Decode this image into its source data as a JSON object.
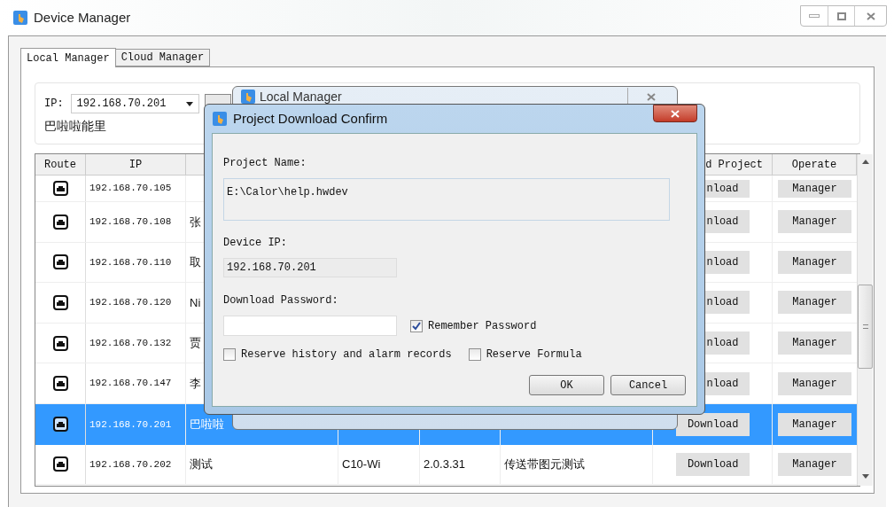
{
  "window": {
    "title": "Device Manager"
  },
  "tabs": [
    {
      "label": "Local Manager",
      "selected": true
    },
    {
      "label": "Cloud Manager",
      "selected": false
    }
  ],
  "ip_bar": {
    "label": "IP:",
    "value": "192.168.70.201",
    "device_name": "巴啦啦能里"
  },
  "table": {
    "headers": {
      "column_1": "Route",
      "column_2": "IP",
      "column_7": "d Project",
      "column_8": "Operate"
    },
    "rows": [
      {
        "ip": "192.168.70.105",
        "download": "nload",
        "operate": "Manager",
        "selected": false
      },
      {
        "ip": "192.168.70.108",
        "name": "张",
        "download": "nload",
        "operate": "Manager",
        "selected": false
      },
      {
        "ip": "192.168.70.110",
        "name": "取",
        "download": "nload",
        "operate": "Manager",
        "selected": false
      },
      {
        "ip": "192.168.70.120",
        "name": "Ni",
        "download": "nload",
        "operate": "Manager",
        "selected": false
      },
      {
        "ip": "192.168.70.132",
        "name": "贾",
        "download": "nload",
        "operate": "Manager",
        "selected": false
      },
      {
        "ip": "192.168.70.147",
        "name": "李",
        "download": "nload",
        "operate": "Manager",
        "selected": false
      },
      {
        "ip": "192.168.70.201",
        "name": "巴啦啦",
        "download": "Download",
        "operate": "Manager",
        "selected": true
      },
      {
        "ip": "192.168.70.202",
        "name": "测试",
        "model": "C10-Wi",
        "version": "2.0.3.31",
        "description": "传送带图元测试",
        "download": "Download",
        "operate": "Manager",
        "selected": false
      }
    ]
  },
  "back_dialog": {
    "title": "Local Manager"
  },
  "dialog": {
    "title": "Project Download Confirm",
    "project_name_label": "Project Name:",
    "project_name": "E:\\Calor\\help.hwdev",
    "device_ip_label": "Device IP:",
    "device_ip": "192.168.70.201",
    "password_label": "Download Password:",
    "remember": {
      "label": "Remember Password",
      "checked": true
    },
    "options": [
      {
        "label": "Reserve history and alarm records",
        "checked": false
      },
      {
        "label": "Reserve Formula",
        "checked": false
      }
    ],
    "buttons": [
      "OK",
      "Cancel"
    ]
  }
}
